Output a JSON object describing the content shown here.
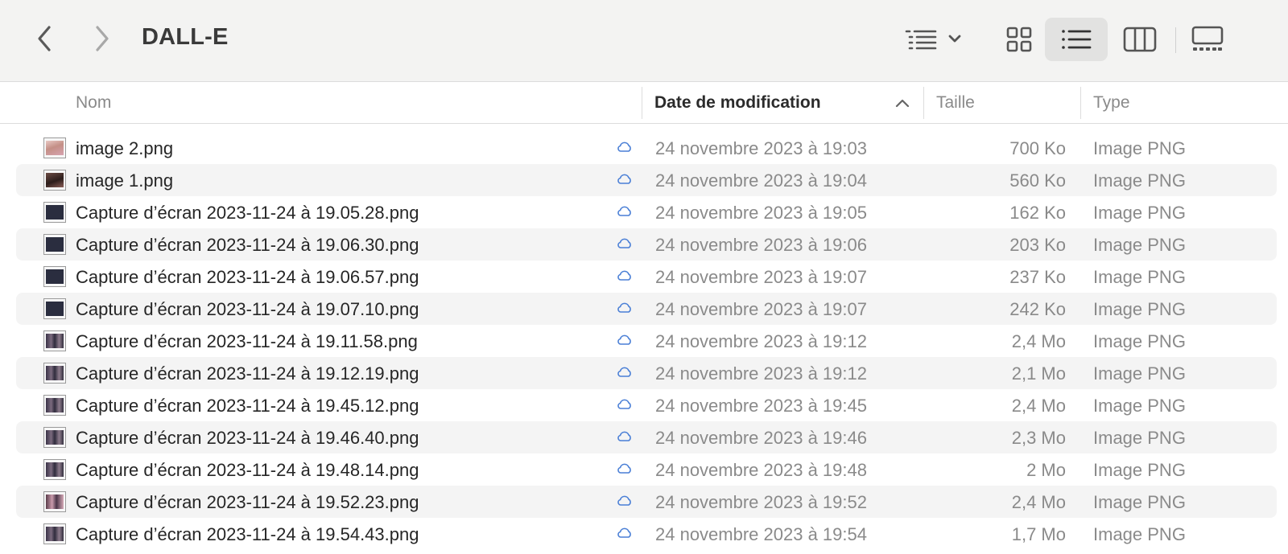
{
  "window": {
    "title": "DALL-E"
  },
  "toolbar": {
    "back_icon": "chevron-left-icon",
    "forward_icon": "chevron-right-icon",
    "group_icon": "list-group-icon",
    "view_icons": "grid-view-icon",
    "view_list": "list-view-icon",
    "view_columns": "column-view-icon",
    "view_gallery": "gallery-view-icon",
    "selected_view": "list"
  },
  "columns": {
    "name": "Nom",
    "date": "Date de modification",
    "size": "Taille",
    "type": "Type",
    "sort_column": "date",
    "sort_direction": "ascending"
  },
  "colors": {
    "cloud_icon": "#4a7fd6",
    "toolbar_bg": "#f3f3f2",
    "alt_row": "#f4f4f4"
  },
  "files": [
    {
      "name": "image 2.png",
      "date": "24 novembre 2023 à 19:03",
      "size": "700 Ko",
      "type": "Image PNG",
      "thumb": "portrait-pink"
    },
    {
      "name": "image 1.png",
      "date": "24 novembre 2023 à 19:04",
      "size": "560 Ko",
      "type": "Image PNG",
      "thumb": "portrait-dark"
    },
    {
      "name": "Capture d’écran 2023-11-24 à 19.05.28.png",
      "date": "24 novembre 2023 à 19:05",
      "size": "162 Ko",
      "type": "Image PNG",
      "thumb": "screen-dark"
    },
    {
      "name": "Capture d’écran 2023-11-24 à 19.06.30.png",
      "date": "24 novembre 2023 à 19:06",
      "size": "203 Ko",
      "type": "Image PNG",
      "thumb": "screen-dark"
    },
    {
      "name": "Capture d’écran 2023-11-24 à 19.06.57.png",
      "date": "24 novembre 2023 à 19:07",
      "size": "237 Ko",
      "type": "Image PNG",
      "thumb": "screen-dark"
    },
    {
      "name": "Capture d’écran 2023-11-24 à 19.07.10.png",
      "date": "24 novembre 2023 à 19:07",
      "size": "242 Ko",
      "type": "Image PNG",
      "thumb": "screen-dark"
    },
    {
      "name": "Capture d’écran 2023-11-24 à 19.11.58.png",
      "date": "24 novembre 2023 à 19:12",
      "size": "2,4 Mo",
      "type": "Image PNG",
      "thumb": "screen-grid"
    },
    {
      "name": "Capture d’écran 2023-11-24 à 19.12.19.png",
      "date": "24 novembre 2023 à 19:12",
      "size": "2,1 Mo",
      "type": "Image PNG",
      "thumb": "screen-grid"
    },
    {
      "name": "Capture d’écran 2023-11-24 à 19.45.12.png",
      "date": "24 novembre 2023 à 19:45",
      "size": "2,4 Mo",
      "type": "Image PNG",
      "thumb": "screen-grid"
    },
    {
      "name": "Capture d’écran 2023-11-24 à 19.46.40.png",
      "date": "24 novembre 2023 à 19:46",
      "size": "2,3 Mo",
      "type": "Image PNG",
      "thumb": "screen-grid"
    },
    {
      "name": "Capture d’écran 2023-11-24 à 19.48.14.png",
      "date": "24 novembre 2023 à 19:48",
      "size": "2 Mo",
      "type": "Image PNG",
      "thumb": "screen-grid"
    },
    {
      "name": "Capture d’écran 2023-11-24 à 19.52.23.png",
      "date": "24 novembre 2023 à 19:52",
      "size": "2,4 Mo",
      "type": "Image PNG",
      "thumb": "screen-pink"
    },
    {
      "name": "Capture d’écran 2023-11-24 à 19.54.43.png",
      "date": "24 novembre 2023 à 19:54",
      "size": "1,7 Mo",
      "type": "Image PNG",
      "thumb": "screen-grid"
    }
  ]
}
